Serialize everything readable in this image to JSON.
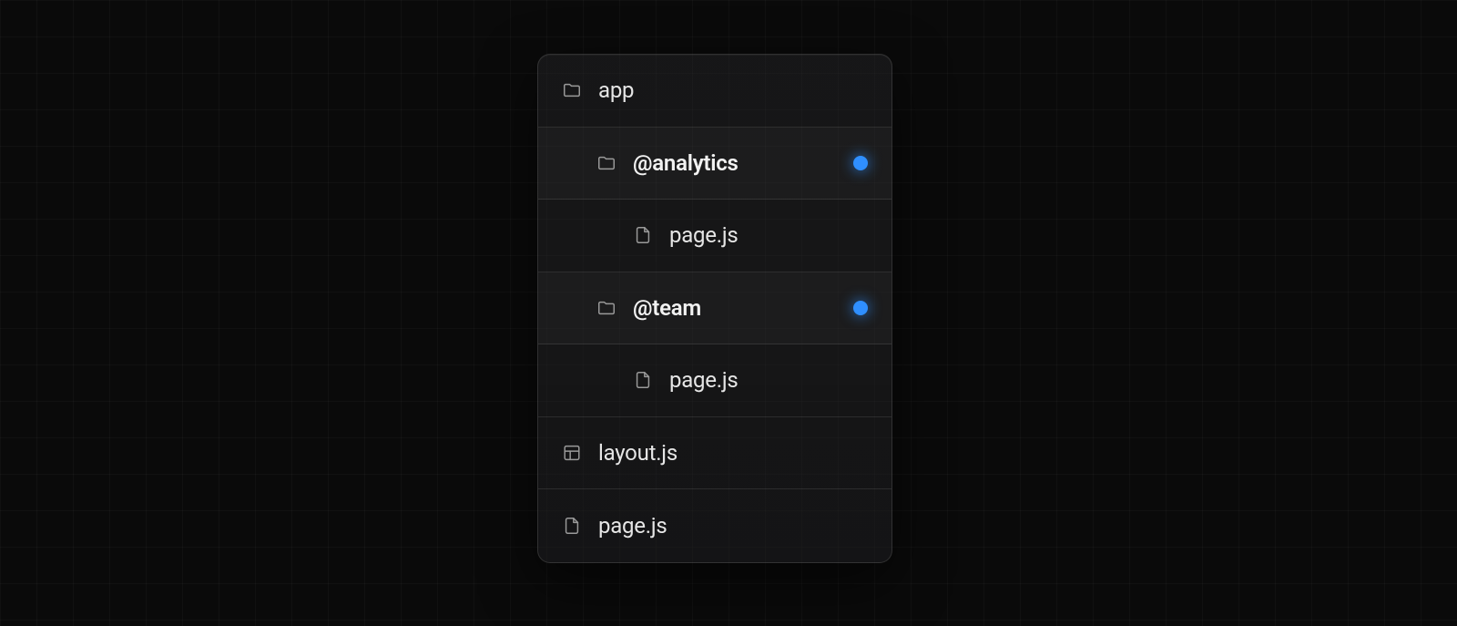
{
  "tree": {
    "root": {
      "label": "app"
    },
    "items": [
      {
        "label": "@analytics",
        "bold": true,
        "marked": true
      },
      {
        "label": "page.js"
      },
      {
        "label": "@team",
        "bold": true,
        "marked": true
      },
      {
        "label": "page.js"
      }
    ],
    "files": [
      {
        "label": "layout.js"
      },
      {
        "label": "page.js"
      }
    ]
  },
  "colors": {
    "mark": "#2f8fff"
  }
}
